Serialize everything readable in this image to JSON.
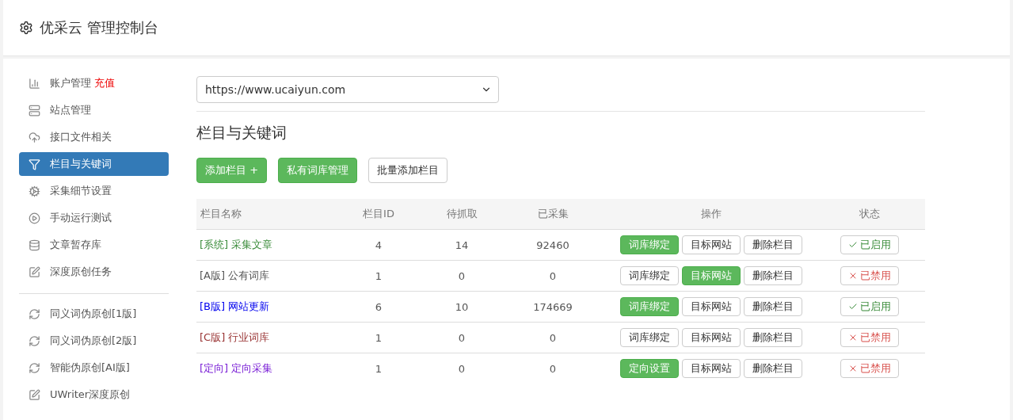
{
  "header": {
    "title": "优采云 管理控制台"
  },
  "sidebar": {
    "groups": [
      [
        {
          "label": "账户管理",
          "badge": "充值",
          "selected": false
        },
        {
          "label": "站点管理",
          "selected": false
        },
        {
          "label": "接口文件相关",
          "selected": false
        },
        {
          "label": "栏目与关键词",
          "selected": true
        },
        {
          "label": "采集细节设置",
          "selected": false
        },
        {
          "label": "手动运行测试",
          "selected": false
        },
        {
          "label": "文章暂存库",
          "selected": false
        },
        {
          "label": "深度原创任务",
          "selected": false
        }
      ],
      [
        {
          "label": "同义词伪原创[1版]",
          "selected": false
        },
        {
          "label": "同义词伪原创[2版]",
          "selected": false
        },
        {
          "label": "智能伪原创[AI版]",
          "selected": false
        },
        {
          "label": "UWriter深度原创",
          "selected": false
        }
      ]
    ]
  },
  "site_select": {
    "value": "https://www.ucaiyun.com"
  },
  "section_title": "栏目与关键词",
  "toolbar": [
    {
      "label": "添加栏目 +",
      "kind": "primary"
    },
    {
      "label": "私有词库管理",
      "kind": "primary"
    },
    {
      "label": "批量添加栏目",
      "kind": "default"
    }
  ],
  "table": {
    "columns": [
      "栏目名称",
      "栏目ID",
      "待抓取",
      "已采集",
      "操作",
      "状态"
    ],
    "rows": [
      {
        "name": "[系统] 采集文章",
        "color": "#3c8d3c",
        "id": "4",
        "pending": "14",
        "collected": "92460",
        "actions": [
          {
            "label": "词库绑定",
            "selected": true
          },
          {
            "label": "目标网站",
            "selected": false
          },
          {
            "label": "删除栏目",
            "selected": false
          }
        ],
        "status": "已启用",
        "enabled": true
      },
      {
        "name": "[A版] 公有词库",
        "color": "#555555",
        "id": "1",
        "pending": "0",
        "collected": "0",
        "actions": [
          {
            "label": "词库绑定",
            "selected": false
          },
          {
            "label": "目标网站",
            "selected": true
          },
          {
            "label": "删除栏目",
            "selected": false
          }
        ],
        "status": "已禁用",
        "enabled": false
      },
      {
        "name": "[B版] 网站更新",
        "color": "#0000ee",
        "id": "6",
        "pending": "10",
        "collected": "174669",
        "actions": [
          {
            "label": "词库绑定",
            "selected": true
          },
          {
            "label": "目标网站",
            "selected": false
          },
          {
            "label": "删除栏目",
            "selected": false
          }
        ],
        "status": "已启用",
        "enabled": true
      },
      {
        "name": "[C版] 行业词库",
        "color": "#993333",
        "id": "1",
        "pending": "0",
        "collected": "0",
        "actions": [
          {
            "label": "词库绑定",
            "selected": false
          },
          {
            "label": "目标网站",
            "selected": false
          },
          {
            "label": "删除栏目",
            "selected": false
          }
        ],
        "status": "已禁用",
        "enabled": false
      },
      {
        "name": "[定向] 定向采集",
        "color": "#7a1fd6",
        "id": "1",
        "pending": "0",
        "collected": "0",
        "actions": [
          {
            "label": "定向设置",
            "selected": true
          },
          {
            "label": "目标网站",
            "selected": false
          },
          {
            "label": "删除栏目",
            "selected": false
          }
        ],
        "status": "已禁用",
        "enabled": false
      }
    ]
  }
}
